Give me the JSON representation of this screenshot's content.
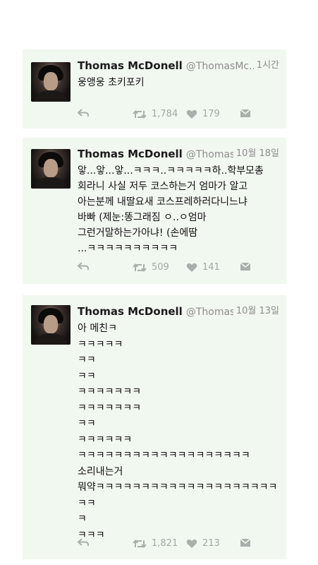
{
  "tweets": [
    {
      "name": "Thomas McDonell",
      "handle": "@ThomasMc...",
      "time": "1시간",
      "lines": [
        "웅앵웅 초키포키"
      ],
      "retweets": "1,784",
      "likes": "179"
    },
    {
      "name": "Thomas McDonell",
      "handle": "@Thomas...",
      "time": "10월 18일",
      "lines": [
        "앟...앟...앟...ㅋㅋㅋ..ㅋㅋㅋㅋㅋ하..학부모총",
        "회라니 사실 저두 코스하는거 엄마가 알고",
        "아는분께 내딸요새 코스프레하러다니느냐",
        "바빠 (제눈:똥그래짐 ㅇ..ㅇ엄마",
        "그런거말하는가아냐! (손에땀",
        "...ㅋㅋㅋㅋㅋㅋㅋㅋㅋㅋ"
      ],
      "retweets": "509",
      "likes": "141"
    },
    {
      "name": "Thomas McDonell",
      "handle": "@Thomas...",
      "time": "10월 13일",
      "lines": [
        "아 메친ㅋ",
        "ㅋㅋㅋㅋㅋ",
        "ㅋㅋ",
        "ㅋㅋ",
        "ㅋㅋㅋㅋㅋㅋㅋ",
        "ㅋㅋㅋㅋㅋㅋㅋ",
        "ㅋㅋ",
        "ㅋㅋㅋㅋㅋㅋ",
        "ㅋㅋㅋㅋㅋㅋㅋㅋㅋㅋㅋㅋㅋㅋㅋㅋㅋㅋㅋ",
        "소리내는거",
        "뭐약ㅋㅋㅋㅋㅋㅋㅋㅋㅋㅋㅋㅋㅋㅋㅋㅋㅋㅋㅋㅋ",
        "ㅋㅋ",
        "ㅋ",
        "ㅋㅋㅋ"
      ],
      "retweets": "1,821",
      "likes": "213"
    }
  ],
  "icons": {
    "reply": "reply-icon",
    "retweet": "retweet-icon",
    "like": "heart-icon",
    "dm": "envelope-icon"
  },
  "colors": {
    "card_bg": "#f1f8ef",
    "icon": "#a9b0ab",
    "name": "#1a1a1a",
    "meta": "#8d8d8d"
  }
}
